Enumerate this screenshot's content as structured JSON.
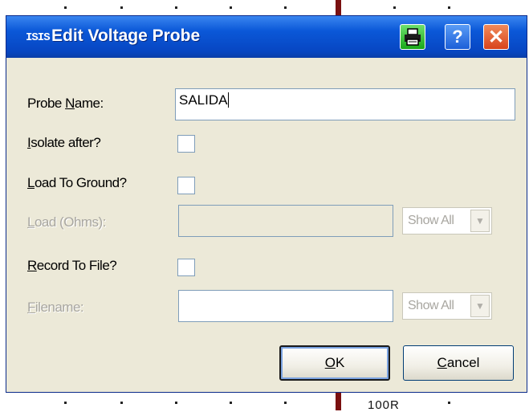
{
  "window": {
    "title": "Edit Voltage Probe",
    "app_icon_text": "ISIS",
    "icons": {
      "print": "printer-icon",
      "help": "help-icon",
      "close": "close-icon"
    },
    "help_label": "?",
    "close_label": "✕"
  },
  "form": {
    "probe_name": {
      "label_pre": "Probe ",
      "label_ul": "N",
      "label_post": "ame:",
      "value": "SALIDA"
    },
    "isolate_after": {
      "label_ul": "I",
      "label_post": "solate after?",
      "checked": false
    },
    "load_to_ground": {
      "label_ul": "L",
      "label_post": "oad To Ground?",
      "checked": false
    },
    "load_ohms": {
      "label_ul": "L",
      "label_post": "oad (Ohms):",
      "value": "",
      "combo": "Show All"
    },
    "record_to_file": {
      "label_ul": "R",
      "label_post": "ecord To File?",
      "checked": false
    },
    "filename": {
      "label_ul": "F",
      "label_post": "ilename:",
      "value": "",
      "combo": "Show All"
    }
  },
  "buttons": {
    "ok_ul": "O",
    "ok_post": "K",
    "cancel_ul": "C",
    "cancel_post": "ancel"
  },
  "background": {
    "text": "100R"
  },
  "colors": {
    "titlebar": "#0b58d8",
    "dialog": "#ece9d8",
    "print_button": "#18a818",
    "close_button": "#d8431c"
  }
}
